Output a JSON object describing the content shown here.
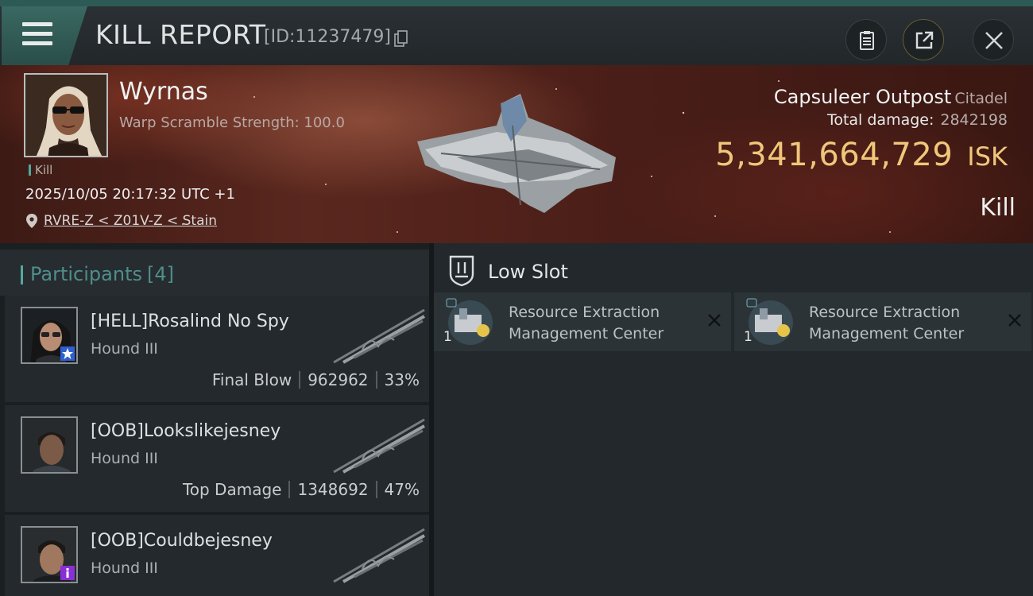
{
  "header": {
    "title": "KILL REPORT",
    "id_text": "[ID:11237479]"
  },
  "victim": {
    "name": "Wyrnas",
    "subtitle": "Warp Scramble Strength: 100.0",
    "kill_tag": "Kill",
    "datetime": "2025/10/05 20:17:32 UTC +1",
    "location": "RVRE-Z < Z01V-Z < Stain"
  },
  "target": {
    "name": "Capsuleer Outpost",
    "class": "Citadel",
    "total_damage_label": "Total damage:",
    "total_damage_value": "2842198",
    "isk_value": "5,341,664,729",
    "isk_unit": "ISK",
    "result": "Kill"
  },
  "participants": {
    "label": "Participants",
    "count": "[4]",
    "rows": [
      {
        "name": "[HELL]Rosalind No Spy",
        "ship": "Hound III",
        "role": "Final Blow",
        "damage": "962962",
        "percent": "33%",
        "badge": "star-badge-icon",
        "badge_color": "#2f5fd0"
      },
      {
        "name": "[OOB]Lookslikejesney",
        "ship": "Hound III",
        "role": "Top Damage",
        "damage": "1348692",
        "percent": "47%"
      },
      {
        "name": "[OOB]Couldbejesney",
        "ship": "Hound III",
        "badge": "info-badge-icon",
        "badge_color": "#8a2fd6"
      }
    ]
  },
  "fitting": {
    "section_label": "Low Slot",
    "modules": [
      {
        "name_line1": "Resource Extraction",
        "name_line2": "Management Center",
        "qty": "1"
      },
      {
        "name_line1": "Resource Extraction",
        "name_line2": "Management Center",
        "qty": "1"
      }
    ]
  },
  "colors": {
    "accent_teal": "#4f8e8a",
    "isk_gold": "#f0c77a",
    "banner_red": "#5a271e"
  }
}
